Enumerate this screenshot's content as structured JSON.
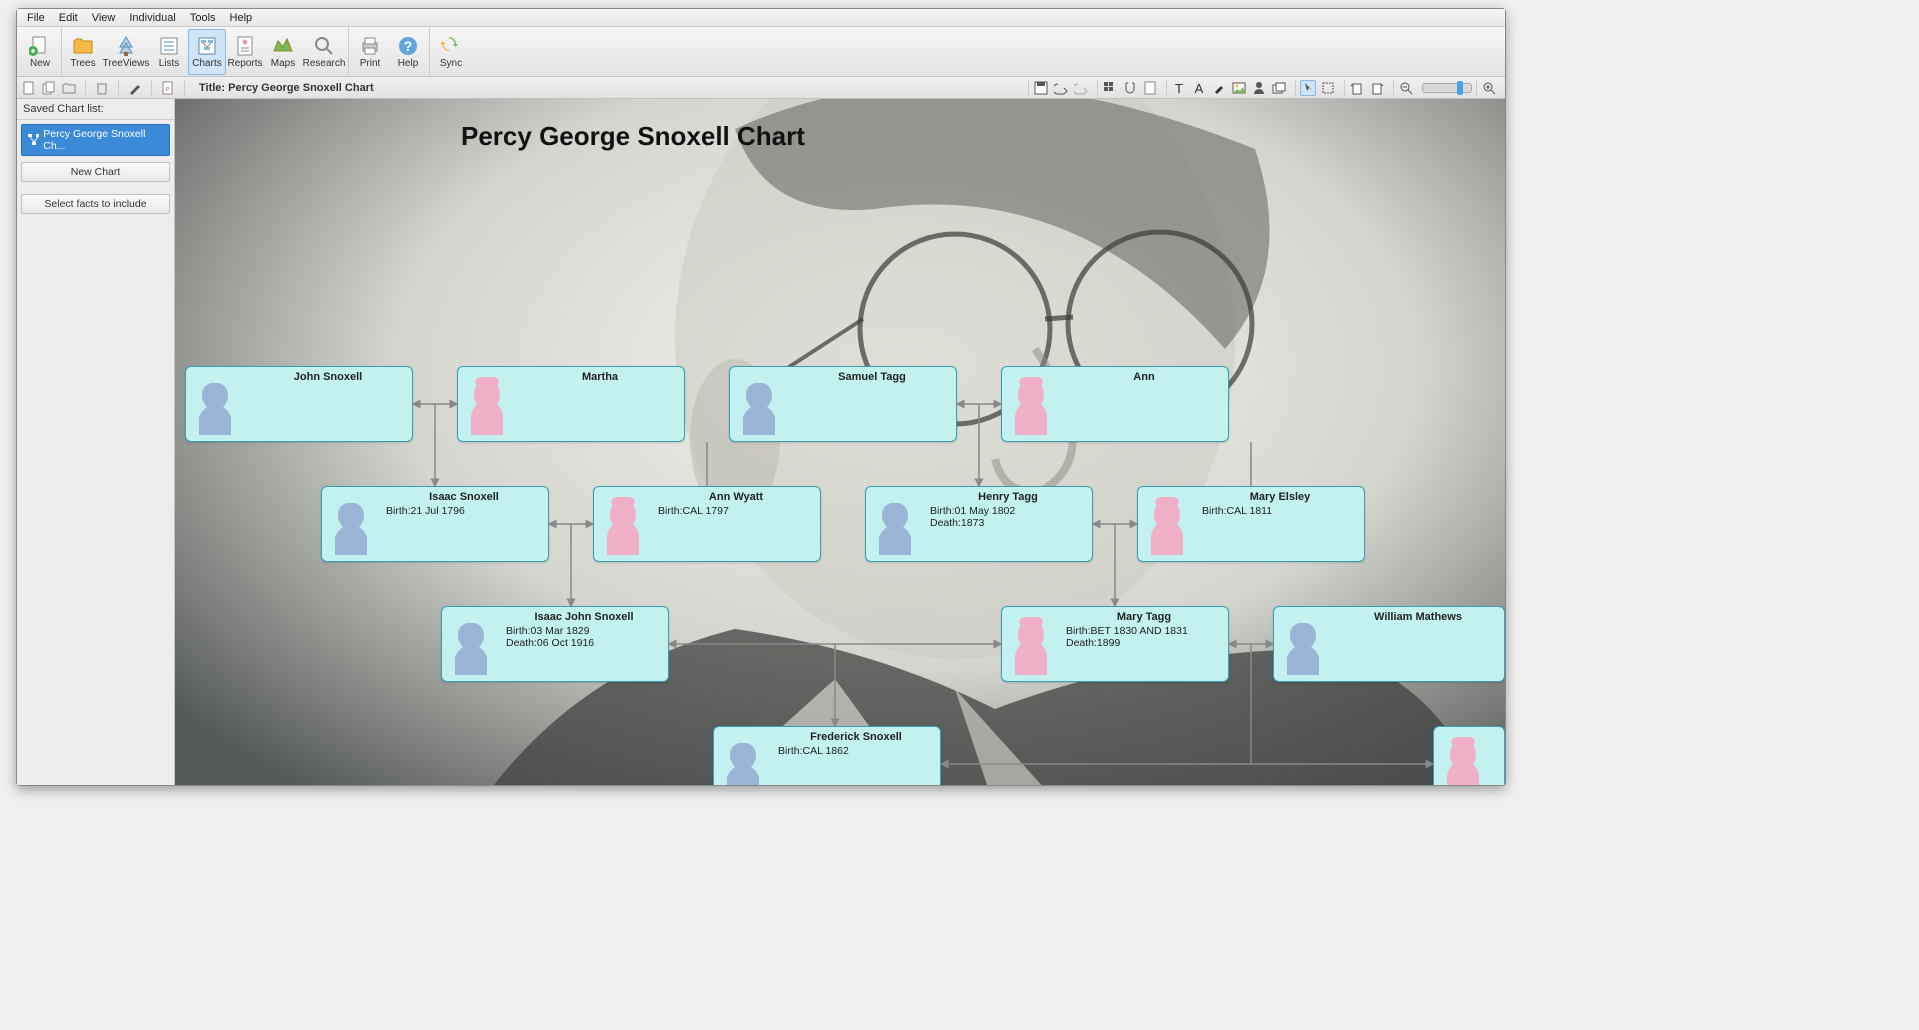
{
  "menu": [
    "File",
    "Edit",
    "View",
    "Individual",
    "Tools",
    "Help"
  ],
  "toolbar": {
    "new": "New",
    "trees": "Trees",
    "treeviews": "TreeViews",
    "lists": "Lists",
    "charts": "Charts",
    "reports": "Reports",
    "maps": "Maps",
    "research": "Research",
    "print": "Print",
    "help": "Help",
    "sync": "Sync"
  },
  "secondary": {
    "title": "Title: Percy George Snoxell Chart"
  },
  "sidebar": {
    "saved_list_label": "Saved Chart list:",
    "chart_name": "Percy George Snoxell Ch...",
    "new_chart": "New Chart",
    "select_facts": "Select facts to include"
  },
  "chart": {
    "title": "Percy George Snoxell Chart",
    "people": {
      "john_snoxell": {
        "name": "John Snoxell"
      },
      "martha": {
        "name": "Martha"
      },
      "samuel_tagg": {
        "name": "Samuel Tagg"
      },
      "ann": {
        "name": "Ann"
      },
      "isaac_snoxell": {
        "name": "Isaac Snoxell",
        "birth": "Birth:21 Jul 1796"
      },
      "ann_wyatt": {
        "name": "Ann Wyatt",
        "birth": "Birth:CAL 1797"
      },
      "henry_tagg": {
        "name": "Henry Tagg",
        "birth": "Birth:01 May 1802",
        "death": "Death:1873"
      },
      "mary_elsley": {
        "name": "Mary Elsley",
        "birth": "Birth:CAL 1811"
      },
      "isaac_john": {
        "name": "Isaac John Snoxell",
        "birth": "Birth:03 Mar 1829",
        "death": "Death:06 Oct 1916"
      },
      "mary_tagg": {
        "name": "Mary Tagg",
        "birth": "Birth:BET 1830 AND 1831",
        "death": "Death:1899"
      },
      "william_mathews": {
        "name": "William Mathews"
      },
      "frederick": {
        "name": "Frederick Snoxell",
        "birth": "Birth:CAL 1862"
      }
    }
  }
}
